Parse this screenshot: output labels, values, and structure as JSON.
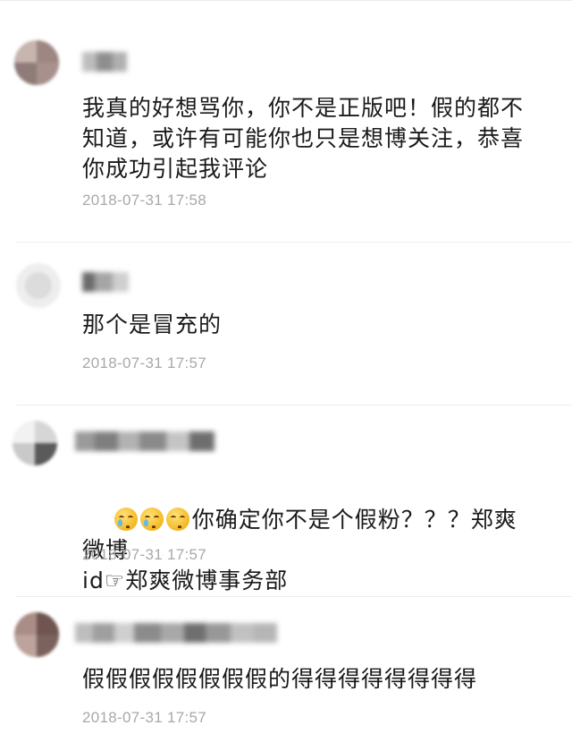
{
  "comments": [
    {
      "text": "我真的好想骂你，你不是正版吧！假的都不知道，或许有可能你也只是想博关注，恭喜你成功引起我评论",
      "time": "2018-07-31 17:58"
    },
    {
      "text": "那个是冒充的",
      "time": "2018-07-31 17:57"
    },
    {
      "text_emojis": [
        "crying-face-emoji",
        "crying-face-emoji",
        "relieved-face-emoji"
      ],
      "text_line1": "你确定你不是个假粉？？？郑爽微博",
      "text_line2": "id☞郑爽微博事务部",
      "time": "2018-07-31 17:57"
    },
    {
      "text": "假假假假假假假假的得得得得得得得得",
      "time": "2018-07-31 17:57"
    }
  ]
}
